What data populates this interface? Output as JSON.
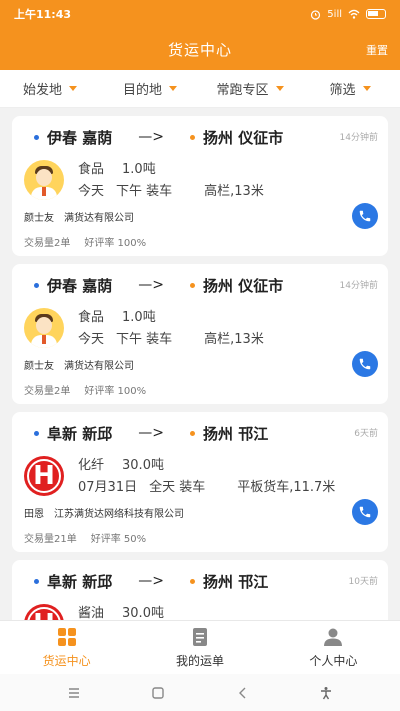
{
  "status_bar": {
    "time": "上午11:43",
    "signal": "5ill",
    "battery": ""
  },
  "header": {
    "title": "货运中心",
    "reset_label": "重置"
  },
  "filters": [
    {
      "label": "始发地"
    },
    {
      "label": "目的地"
    },
    {
      "label": "常跑专区"
    },
    {
      "label": "筛选"
    }
  ],
  "cards": [
    {
      "origin": "伊春 嘉荫",
      "arrow": "—>",
      "destination": "扬州 仪征市",
      "time_ago": "14分钟前",
      "avatar": "person",
      "goods": "食品",
      "weight": "1.0吨",
      "day": "今天",
      "period": "下午 装车",
      "truck": "高栏,13米",
      "contact": "颜士友",
      "company": "满货达有限公司",
      "deals": "交易量2单",
      "rating": "好评率 100%"
    },
    {
      "origin": "伊春 嘉荫",
      "arrow": "—>",
      "destination": "扬州 仪征市",
      "time_ago": "14分钟前",
      "avatar": "person",
      "goods": "食品",
      "weight": "1.0吨",
      "day": "今天",
      "period": "下午 装车",
      "truck": "高栏,13米",
      "contact": "颜士友",
      "company": "满货达有限公司",
      "deals": "交易量2单",
      "rating": "好评率 100%"
    },
    {
      "origin": "阜新 新邱",
      "arrow": "—>",
      "destination": "扬州 邗江",
      "time_ago": "6天前",
      "avatar": "logo",
      "avatar_letter": "H",
      "goods": "化纤",
      "weight": "30.0吨",
      "day": "07月31日",
      "period": "全天 装车",
      "truck": "平板货车,11.7米",
      "contact": "田恩",
      "company": "江苏满货达网络科技有限公司",
      "deals": "交易量21单",
      "rating": "好评率 50%"
    },
    {
      "origin": "阜新 新邱",
      "arrow": "—>",
      "destination": "扬州 邗江",
      "time_ago": "10天前",
      "avatar": "logo",
      "avatar_letter": "H",
      "goods": "酱油",
      "weight": "30.0吨",
      "day": "",
      "period": "",
      "truck": "",
      "contact": "",
      "company": "",
      "deals": "",
      "rating": ""
    }
  ],
  "tabs": [
    {
      "label": "货运中心",
      "icon": "grid-icon",
      "active": true
    },
    {
      "label": "我的运单",
      "icon": "document-icon",
      "active": false
    },
    {
      "label": "个人中心",
      "icon": "person-icon",
      "active": false
    }
  ],
  "colors": {
    "accent": "#f5921e",
    "phone": "#2b78e4",
    "logo": "#e02020"
  }
}
